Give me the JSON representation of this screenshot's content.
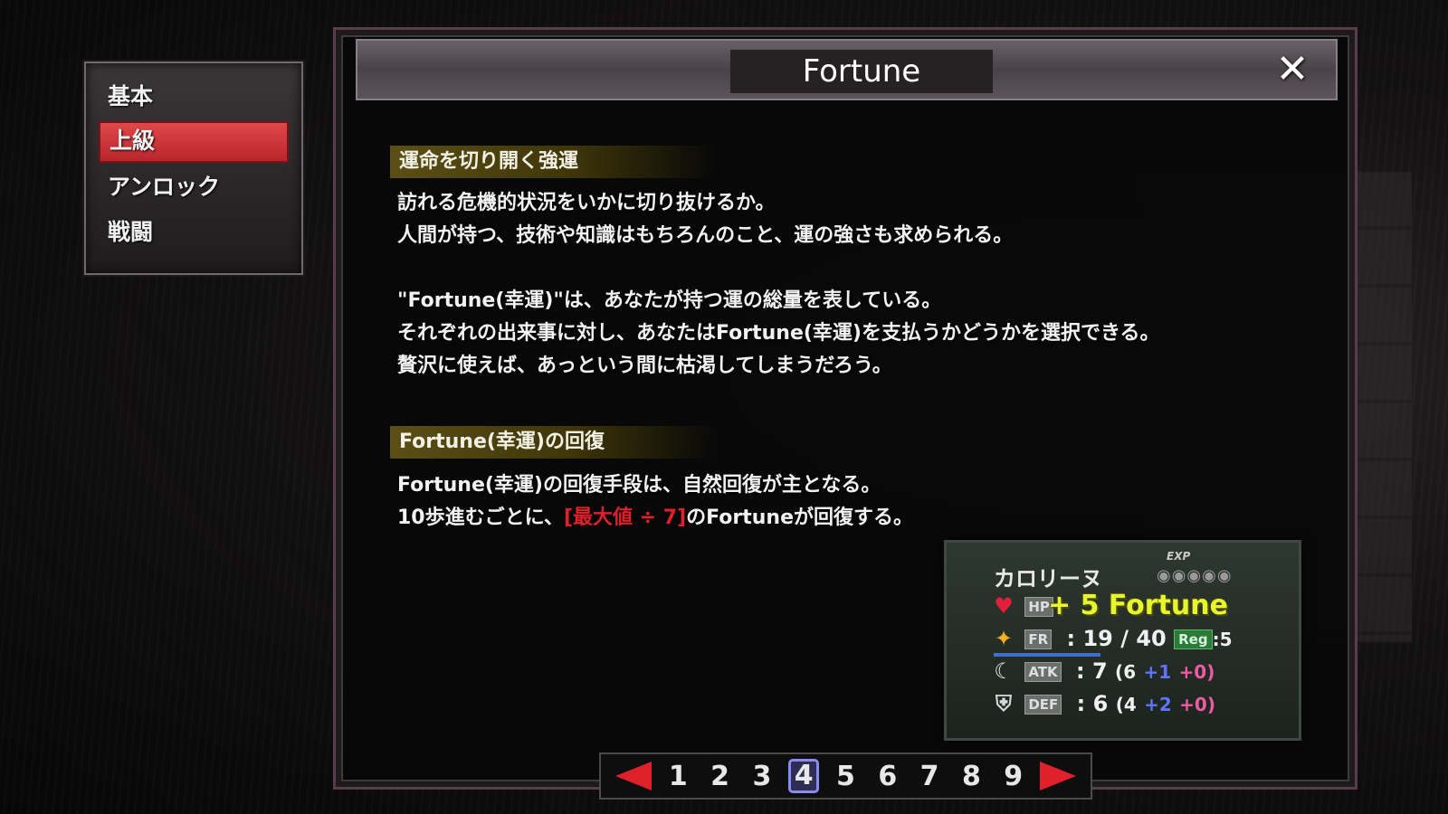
{
  "side_menu": {
    "items": [
      {
        "label": "基本"
      },
      {
        "label": "上級"
      },
      {
        "label": "アンロック"
      },
      {
        "label": "戦闘"
      }
    ]
  },
  "panel": {
    "title": "Fortune",
    "close_label": "✕",
    "sections": [
      {
        "heading": "運命を切り開く強運",
        "lines": [
          "訪れる危機的状況をいかに切り抜けるか。",
          "人間が持つ、技術や知識はもちろんのこと、運の強さも求められる。",
          "",
          "\"Fortune(幸運)\"は、あなたが持つ運の総量を表している。",
          "それぞれの出来事に対し、あなたはFortune(幸運)を支払うかどうかを選択できる。",
          "贅沢に使えば、あっという間に枯渇してしまうだろう。"
        ]
      },
      {
        "heading": "Fortune(幸運)の回復",
        "line1": "Fortune(幸運)の回復手段は、自然回復が主となる。",
        "line2_a": "10歩進むごとに、",
        "line2_red": "[最大値 ÷ 7]",
        "line2_b": "のFortuneが回復する。"
      }
    ]
  },
  "status": {
    "name": "カロリーヌ",
    "exp_label": "EXP",
    "exp_pips": "◉◉◉◉◉",
    "hp_tag": "HP",
    "fortune_popup": "+ 5 Fortune",
    "fr_tag": "FR",
    "fr_value": ": 19 / 40",
    "reg_tag": "Reg",
    "reg_value": ":5",
    "atk_tag": "ATK",
    "atk_value": ": 7",
    "atk_base": "(6",
    "atk_plus1": "+1",
    "atk_plus2": "+0)",
    "def_tag": "DEF",
    "def_value": ": 6",
    "def_base": "(4",
    "def_plus1": "+2",
    "def_plus2": "+0)"
  },
  "pager": {
    "pages": [
      "1",
      "2",
      "3",
      "4",
      "5",
      "6",
      "7",
      "8",
      "9"
    ],
    "current": "4"
  },
  "colors": {
    "accent_red": "#e0202a",
    "fortune_yellow": "#e7f52c",
    "active_menu": "#d03a3e"
  }
}
